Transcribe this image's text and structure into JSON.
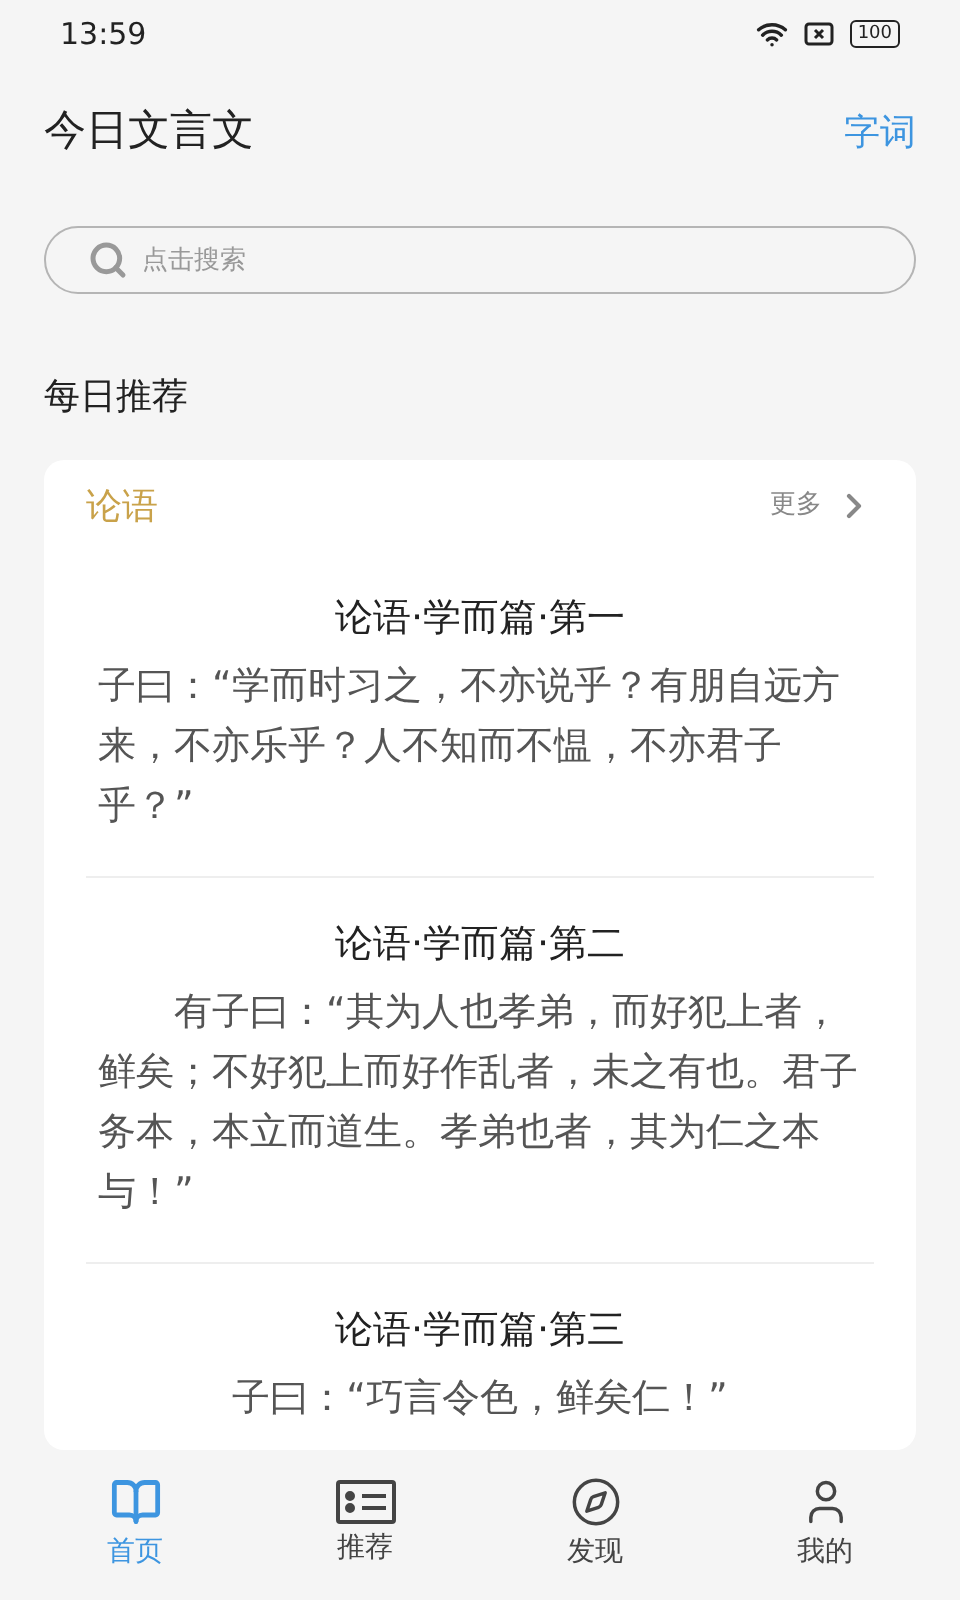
{
  "status_bar": {
    "time": "13:59",
    "battery": "100"
  },
  "header": {
    "title": "今日文言文",
    "action": "字词"
  },
  "search": {
    "placeholder": "点击搜索"
  },
  "section": {
    "title": "每日推荐"
  },
  "card": {
    "title": "论语",
    "more": "更多",
    "passages": [
      {
        "kind": "plain",
        "title": "论语·学而篇·第一",
        "text": "子曰：“学而时习之，不亦说乎？有朋自远方来，不亦乐乎？人不知而不愠，不亦君子乎？”"
      },
      {
        "kind": "indented",
        "title": "论语·学而篇·第二",
        "text": "有子曰：“其为人也孝弟，而好犯上者，鲜矣；不好犯上而好作乱者，未之有也。君子务本，本立而道生。孝弟也者，其为仁之本与！”"
      },
      {
        "kind": "centered",
        "title": "论语·学而篇·第三",
        "text": "子曰：“巧言令色，鲜矣仁！”"
      }
    ]
  },
  "tabs": [
    {
      "kind": "book",
      "label": "首页",
      "selected": true
    },
    {
      "kind": "list",
      "label": "推荐",
      "selected": false
    },
    {
      "kind": "compass",
      "label": "发现",
      "selected": false
    },
    {
      "kind": "user",
      "label": "我的",
      "selected": false
    }
  ]
}
